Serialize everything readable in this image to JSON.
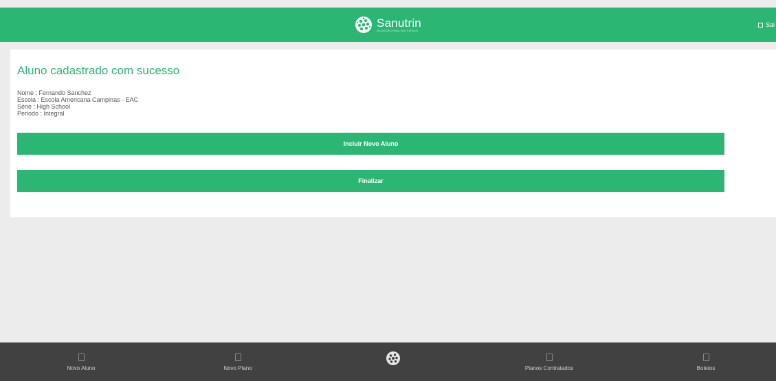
{
  "header": {
    "brand_name": "Sanutrin",
    "brand_tagline": "SOLUÇÕES PARA SEU ESPAÇO",
    "exit_label": "Sai"
  },
  "main": {
    "title": "Aluno cadastrado com sucesso",
    "details": [
      {
        "label": "Nome",
        "value": "Fernando Sanchez",
        "text": "Nome : Fernando Sanchez"
      },
      {
        "label": "Escola",
        "value": "Escola Americana Campinas - EAC",
        "text": "Escola : Escola Americana Campinas - EAC"
      },
      {
        "label": "Série",
        "value": "High School",
        "text": "Série : High School"
      },
      {
        "label": "Periodo",
        "value": "Integral",
        "text": "Periodo : Integral"
      }
    ],
    "add_button_label": "Incluir Novo Aluno",
    "finish_button_label": "Finalizar"
  },
  "bottom_nav": {
    "items": [
      {
        "label": "Novo Aluno",
        "icon": "square-icon"
      },
      {
        "label": "Novo Plano",
        "icon": "square-icon"
      },
      {
        "label": "Planos Contratados",
        "icon": "square-icon"
      },
      {
        "label": "Boletos",
        "icon": "square-icon"
      }
    ],
    "center_icon": "sanutrin-logo-icon"
  },
  "colors": {
    "brand_green": "#2bb673",
    "background": "#ececec",
    "bottom_bar": "#414141"
  }
}
